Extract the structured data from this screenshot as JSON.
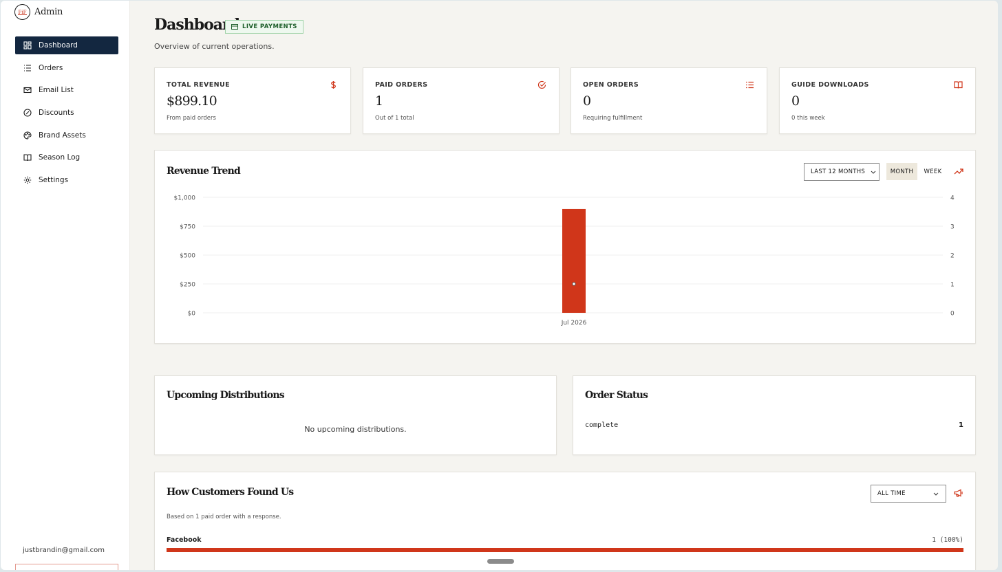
{
  "brand": {
    "name": "Admin",
    "logo_text": "FiF"
  },
  "nav": [
    {
      "label": "Dashboard",
      "icon": "dashboard-icon",
      "active": true
    },
    {
      "label": "Orders",
      "icon": "list-icon"
    },
    {
      "label": "Email List",
      "icon": "mail-icon"
    },
    {
      "label": "Discounts",
      "icon": "discount-icon"
    },
    {
      "label": "Brand Assets",
      "icon": "palette-icon"
    },
    {
      "label": "Season Log",
      "icon": "book-icon"
    },
    {
      "label": "Settings",
      "icon": "gear-icon"
    }
  ],
  "user": {
    "email": "justbrandin@gmail.com"
  },
  "page": {
    "title": "Dashboard",
    "badge": "LIVE PAYMENTS",
    "subtitle": "Overview of current operations."
  },
  "stats": [
    {
      "label": "TOTAL REVENUE",
      "value": "$899.10",
      "sub": "From paid orders",
      "icon": "dollar-icon"
    },
    {
      "label": "PAID ORDERS",
      "value": "1",
      "sub": "Out of 1 total",
      "icon": "check-circle-icon"
    },
    {
      "label": "OPEN ORDERS",
      "value": "0",
      "sub": "Requiring fulfillment",
      "icon": "list-icon"
    },
    {
      "label": "GUIDE DOWNLOADS",
      "value": "0",
      "sub": "0 this week",
      "icon": "book-icon"
    }
  ],
  "revenue": {
    "title": "Revenue Trend",
    "range_select": "LAST 12 MONTHS",
    "toggle": [
      {
        "label": "MONTH",
        "on": true
      },
      {
        "label": "WEEK",
        "on": false
      }
    ]
  },
  "chart_data": {
    "type": "bar",
    "title": "Revenue Trend",
    "categories": [
      "Jul 2026"
    ],
    "series": [
      {
        "kind": "bar",
        "axis": "left",
        "values": [
          899.1
        ]
      },
      {
        "kind": "line",
        "axis": "right",
        "values": [
          1
        ]
      }
    ],
    "y_left": {
      "ticks": [
        "$0",
        "$250",
        "$500",
        "$750",
        "$1,000"
      ],
      "ylim": [
        0,
        1000
      ]
    },
    "y_right": {
      "ticks": [
        "0",
        "1",
        "2",
        "3",
        "4"
      ],
      "ylim": [
        0,
        4
      ]
    },
    "grid": true,
    "color": "#d0361a"
  },
  "distributions": {
    "title": "Upcoming Distributions",
    "empty": "No upcoming distributions."
  },
  "order_status": {
    "title": "Order Status",
    "rows": [
      {
        "status": "complete",
        "count": "1"
      }
    ]
  },
  "sources": {
    "title": "How Customers Found Us",
    "select": "ALL TIME",
    "caption": "Based on 1 paid order with a response.",
    "rows": [
      {
        "name": "Facebook",
        "count": "1 (100%)",
        "fraction": 1.0
      }
    ]
  },
  "colors": {
    "accent": "#d0361a",
    "nav_active": "#132740",
    "badge": "#1d5e2a"
  }
}
